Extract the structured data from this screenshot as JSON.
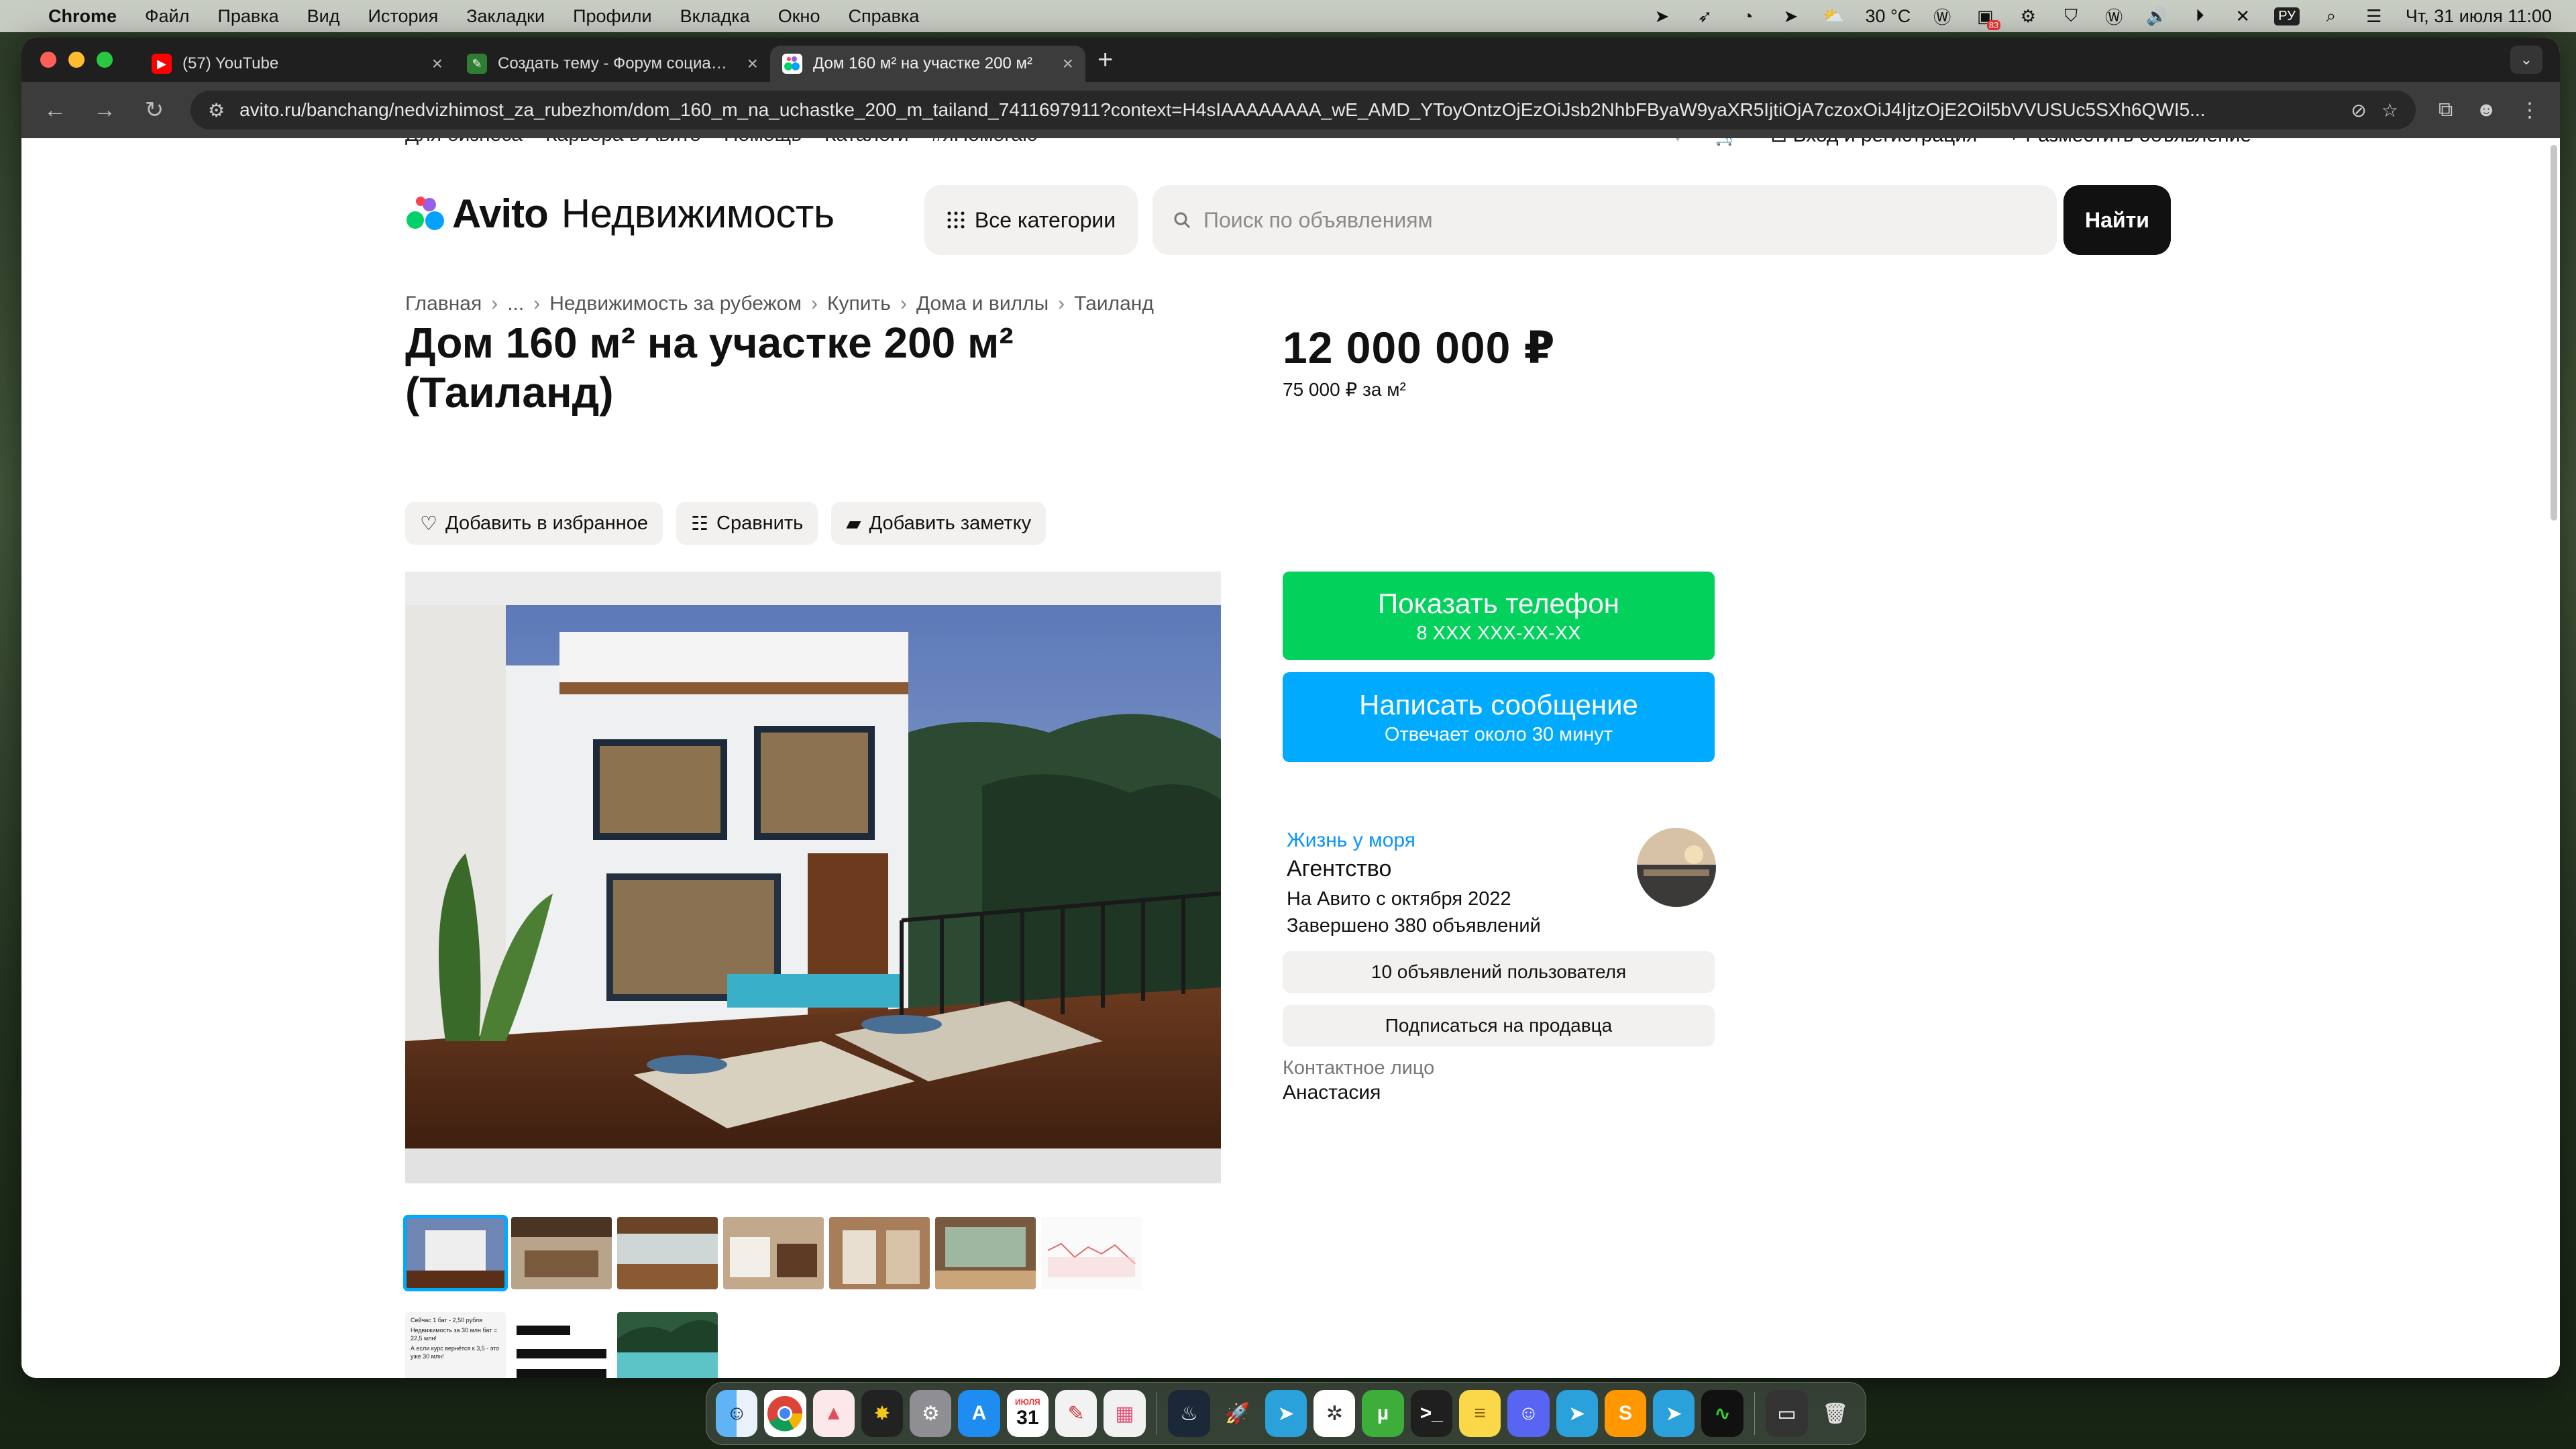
{
  "menubar": {
    "app": "Chrome",
    "items": [
      "Файл",
      "Правка",
      "Вид",
      "История",
      "Закладки",
      "Профили",
      "Вкладка",
      "Окно",
      "Справка"
    ],
    "weather": "30 °C",
    "keyboard": "РУ",
    "badge": "83",
    "datetime": "Чт, 31 июля  11:00"
  },
  "browser": {
    "tabs": [
      {
        "title": "(57) YouTube",
        "icon": "youtube-icon",
        "color": "#ff0000"
      },
      {
        "title": "Создать тему - Форум социальн",
        "icon": "forum-icon",
        "color": "#2e7d32"
      },
      {
        "title": "Дом 160 м² на участке 200 м²",
        "icon": "avito-icon",
        "color": "#04a1ff",
        "active": true
      }
    ],
    "url": "avito.ru/banchang/nedvizhimost_za_rubezhom/dom_160_m_na_uchastke_200_m_tailand_7411697911?context=H4sIAAAAAAAA_wE_AMD_YToyOntzOjEzOiJsb2NhbFByaW9yaXR5IjtiOjA7czoxOiJ4IjtzOjE2Oil5bVVUSUc5SXh6QWI5..."
  },
  "avito": {
    "topnav": {
      "left": [
        "Для бизнеса",
        "Карьера в Авито",
        "Помощь",
        "Каталоги",
        "#яПомогаю"
      ],
      "login": "Вход и регистрация",
      "post": "Разместить объявление"
    },
    "logo": {
      "brand": "Avito",
      "section": "Недвижимость"
    },
    "categories_label": "Все категории",
    "search_placeholder": "Поиск по объявлениям",
    "search_button": "Найти",
    "breadcrumb": [
      "Главная",
      "...",
      "Недвижимость за рубежом",
      "Купить",
      "Дома и виллы",
      "Таиланд"
    ],
    "title": "Дом 160 м² на участке 200 м² (Таиланд)",
    "actions": {
      "favorite": "Добавить в избранное",
      "compare": "Сравнить",
      "note": "Добавить заметку"
    },
    "price": "12 000 000 ₽",
    "price_per_sqm": "75 000 ₽ за м²",
    "phone_button": {
      "label": "Показать телефон",
      "sub": "8 XXX XXX-XX-XX"
    },
    "message_button": {
      "label": "Написать сообщение",
      "sub": "Отвечает около 30 минут"
    },
    "seller": {
      "name": "Жизнь у моря",
      "type": "Агентство",
      "since": "На Авито с октября 2022",
      "completed": "Завершено 380 объявлений",
      "listings_button": "10 объявлений пользователя",
      "subscribe_button": "Подписаться на продавца",
      "contact_label": "Контактное лицо",
      "contact_name": "Анастасия"
    },
    "thumbnails_count": 10,
    "thumb_texts": {
      "t8_line1": "Сейчас 1 бат - 2,50 рубля",
      "t8_line2": "Недвижимость за 30 млн бат = 22,5 млн!",
      "t8_line3": "А если курс вернётся к 3,5 - это уже 30 млн!"
    }
  },
  "dock": {
    "calendar_month": "ИЮЛЯ",
    "calendar_day": "31",
    "apps": [
      "finder-icon",
      "chrome-icon",
      "arc-icon",
      "sparkle-icon",
      "system-settings-icon",
      "app-store-icon",
      "calendar-icon",
      "notes-icon",
      "launchpad-icon",
      "steam-icon",
      "rocket-icon",
      "telegram-icon",
      "chatgpt-icon",
      "utorrent-icon",
      "terminal-icon",
      "notes-yellow-icon",
      "discord-icon",
      "telegram-icon",
      "sublime-icon",
      "telegram-icon",
      "activity-monitor-icon",
      "screen-icon",
      "trash-icon"
    ]
  }
}
